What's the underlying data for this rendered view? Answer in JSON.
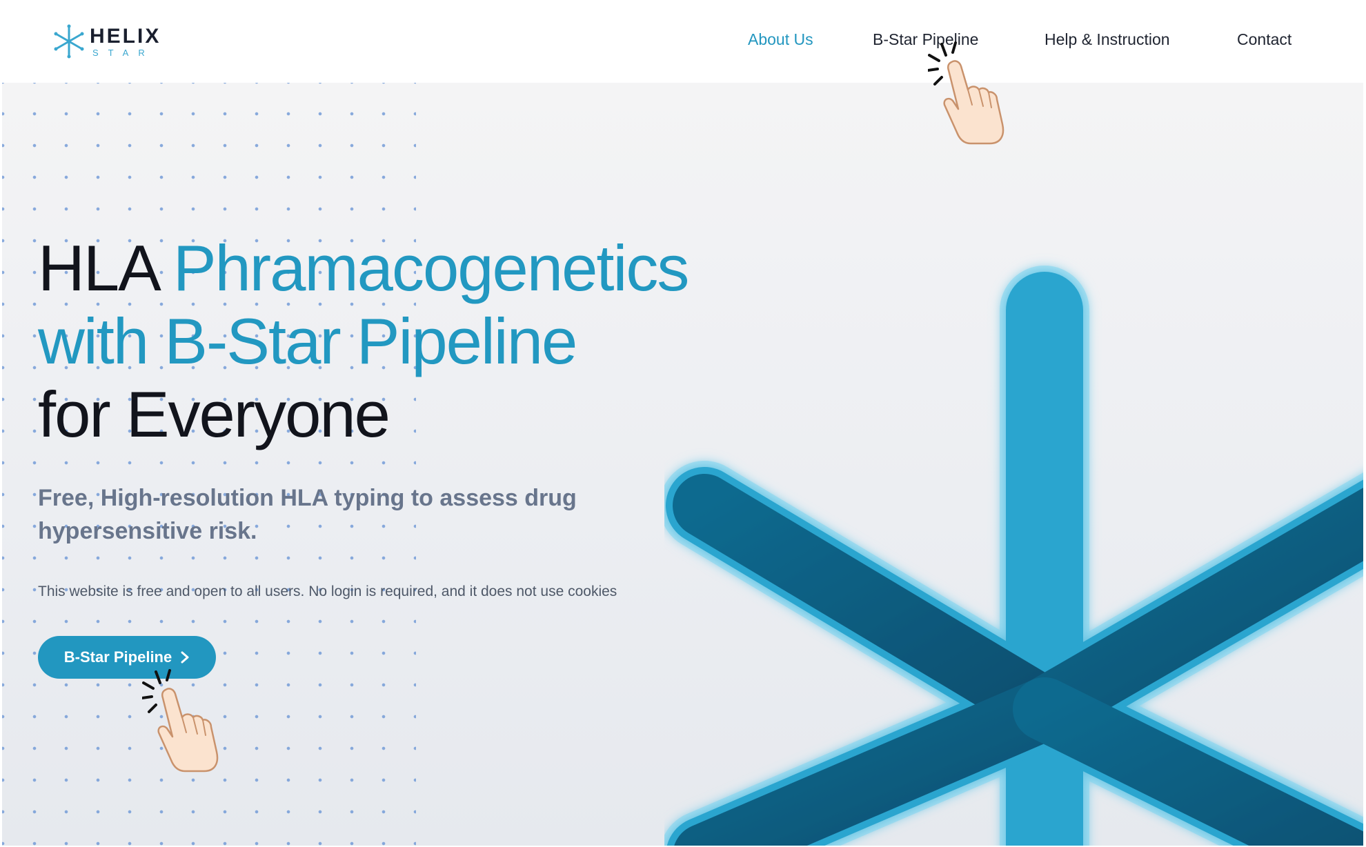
{
  "header": {
    "logo": {
      "wordmark": "HELIX",
      "submark": "STAR",
      "icon": "asterisk-logo-icon"
    },
    "nav": [
      {
        "label": "About Us",
        "active": true
      },
      {
        "label": "B-Star Pipeline",
        "active": false
      },
      {
        "label": "Help & Instruction",
        "active": false
      },
      {
        "label": "Contact",
        "active": false
      }
    ]
  },
  "hero": {
    "headline": {
      "part1": "HLA",
      "part2": "Phramacogenetics",
      "part3": "with B-Star Pipeline",
      "part4": "for Everyone"
    },
    "subheadline": "Free, High-resolution HLA typing to assess drug hypersensitive risk.",
    "notice": "This website is free and open to all users. No login is required, and it does not use cookies",
    "cta": {
      "label": "B-Star Pipeline",
      "icon": "chevron-right-icon"
    },
    "graphic": "glowing-asterisk-icon",
    "pointers": [
      "pointing-hand-icon",
      "pointing-hand-icon"
    ]
  },
  "colors": {
    "accent": "#2297c0",
    "heading": "#12141c",
    "subtext": "#68758c",
    "dots": "#6d97d6"
  }
}
